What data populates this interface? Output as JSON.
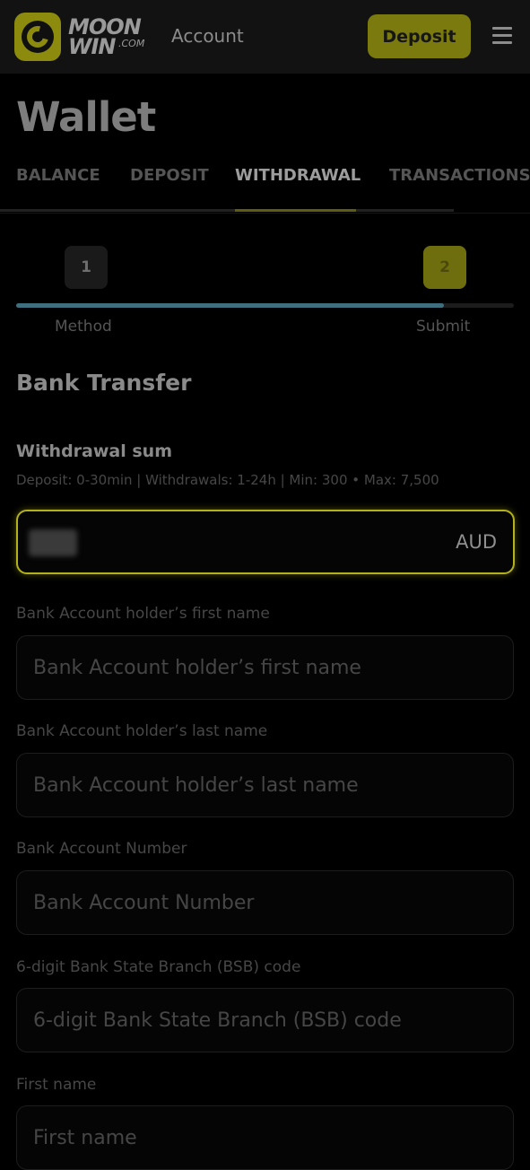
{
  "header": {
    "brand_line1": "MOON",
    "brand_line2": "WIN",
    "brand_suffix": ".COM",
    "account_label": "Account",
    "deposit_label": "Deposit",
    "menu_icon": "hamburger-menu-icon",
    "accent_color": "#b3b21a"
  },
  "page": {
    "title": "Wallet"
  },
  "tabs": [
    {
      "label": "BALANCE",
      "active": false
    },
    {
      "label": "DEPOSIT",
      "active": false
    },
    {
      "label": "WITHDRAWAL",
      "active": true
    },
    {
      "label": "TRANSACTIONS",
      "active": false
    }
  ],
  "stepper": {
    "steps": [
      {
        "number": "1",
        "label": "Method"
      },
      {
        "number": "2",
        "label": "Submit"
      }
    ],
    "progress_percent": 86,
    "progress_color": "#3f6f7e"
  },
  "form": {
    "method_title": "Bank Transfer",
    "sum_label": "Withdrawal sum",
    "sum_info": "Deposit: 0-30min | Withdrawals: 1-24h | Min: 300 • Max: 7,500",
    "currency": "AUD",
    "fields": [
      {
        "label": "Bank Account holder’s first name",
        "placeholder": "Bank Account holder’s first name"
      },
      {
        "label": "Bank Account holder’s last name",
        "placeholder": "Bank Account holder’s last name"
      },
      {
        "label": "Bank Account Number",
        "placeholder": "Bank Account Number"
      },
      {
        "label": "6-digit Bank State Branch (BSB) code",
        "placeholder": "6-digit Bank State Branch (BSB) code"
      },
      {
        "label": "First name",
        "placeholder": "First name"
      }
    ]
  }
}
